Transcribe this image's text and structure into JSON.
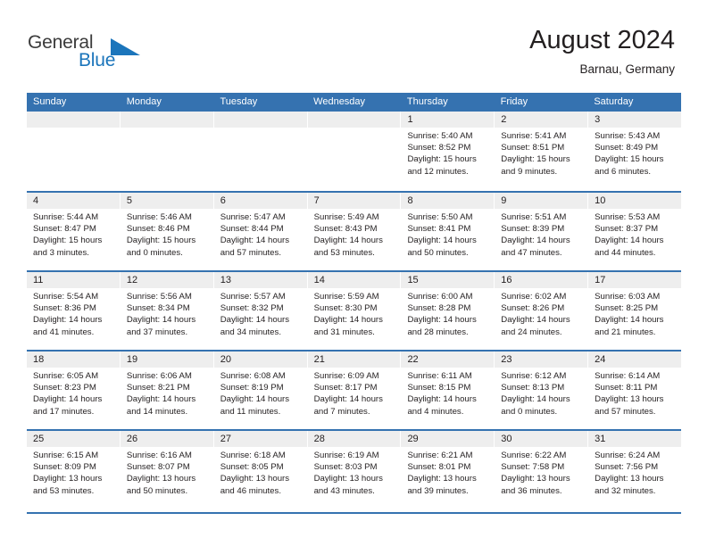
{
  "brand": {
    "name_part1": "General",
    "name_part2": "Blue",
    "accent_color": "#1b75bb"
  },
  "header": {
    "title": "August 2024",
    "location": "Barnau, Germany"
  },
  "theme": {
    "header_row_color": "#3572b0",
    "day_band_color": "#eeeeee",
    "text_color": "#231f20"
  },
  "weekdays": [
    "Sunday",
    "Monday",
    "Tuesday",
    "Wednesday",
    "Thursday",
    "Friday",
    "Saturday"
  ],
  "weeks": [
    [
      {
        "day": "",
        "lines": []
      },
      {
        "day": "",
        "lines": []
      },
      {
        "day": "",
        "lines": []
      },
      {
        "day": "",
        "lines": []
      },
      {
        "day": "1",
        "lines": [
          "Sunrise: 5:40 AM",
          "Sunset: 8:52 PM",
          "Daylight: 15 hours",
          "and 12 minutes."
        ]
      },
      {
        "day": "2",
        "lines": [
          "Sunrise: 5:41 AM",
          "Sunset: 8:51 PM",
          "Daylight: 15 hours",
          "and 9 minutes."
        ]
      },
      {
        "day": "3",
        "lines": [
          "Sunrise: 5:43 AM",
          "Sunset: 8:49 PM",
          "Daylight: 15 hours",
          "and 6 minutes."
        ]
      }
    ],
    [
      {
        "day": "4",
        "lines": [
          "Sunrise: 5:44 AM",
          "Sunset: 8:47 PM",
          "Daylight: 15 hours",
          "and 3 minutes."
        ]
      },
      {
        "day": "5",
        "lines": [
          "Sunrise: 5:46 AM",
          "Sunset: 8:46 PM",
          "Daylight: 15 hours",
          "and 0 minutes."
        ]
      },
      {
        "day": "6",
        "lines": [
          "Sunrise: 5:47 AM",
          "Sunset: 8:44 PM",
          "Daylight: 14 hours",
          "and 57 minutes."
        ]
      },
      {
        "day": "7",
        "lines": [
          "Sunrise: 5:49 AM",
          "Sunset: 8:43 PM",
          "Daylight: 14 hours",
          "and 53 minutes."
        ]
      },
      {
        "day": "8",
        "lines": [
          "Sunrise: 5:50 AM",
          "Sunset: 8:41 PM",
          "Daylight: 14 hours",
          "and 50 minutes."
        ]
      },
      {
        "day": "9",
        "lines": [
          "Sunrise: 5:51 AM",
          "Sunset: 8:39 PM",
          "Daylight: 14 hours",
          "and 47 minutes."
        ]
      },
      {
        "day": "10",
        "lines": [
          "Sunrise: 5:53 AM",
          "Sunset: 8:37 PM",
          "Daylight: 14 hours",
          "and 44 minutes."
        ]
      }
    ],
    [
      {
        "day": "11",
        "lines": [
          "Sunrise: 5:54 AM",
          "Sunset: 8:36 PM",
          "Daylight: 14 hours",
          "and 41 minutes."
        ]
      },
      {
        "day": "12",
        "lines": [
          "Sunrise: 5:56 AM",
          "Sunset: 8:34 PM",
          "Daylight: 14 hours",
          "and 37 minutes."
        ]
      },
      {
        "day": "13",
        "lines": [
          "Sunrise: 5:57 AM",
          "Sunset: 8:32 PM",
          "Daylight: 14 hours",
          "and 34 minutes."
        ]
      },
      {
        "day": "14",
        "lines": [
          "Sunrise: 5:59 AM",
          "Sunset: 8:30 PM",
          "Daylight: 14 hours",
          "and 31 minutes."
        ]
      },
      {
        "day": "15",
        "lines": [
          "Sunrise: 6:00 AM",
          "Sunset: 8:28 PM",
          "Daylight: 14 hours",
          "and 28 minutes."
        ]
      },
      {
        "day": "16",
        "lines": [
          "Sunrise: 6:02 AM",
          "Sunset: 8:26 PM",
          "Daylight: 14 hours",
          "and 24 minutes."
        ]
      },
      {
        "day": "17",
        "lines": [
          "Sunrise: 6:03 AM",
          "Sunset: 8:25 PM",
          "Daylight: 14 hours",
          "and 21 minutes."
        ]
      }
    ],
    [
      {
        "day": "18",
        "lines": [
          "Sunrise: 6:05 AM",
          "Sunset: 8:23 PM",
          "Daylight: 14 hours",
          "and 17 minutes."
        ]
      },
      {
        "day": "19",
        "lines": [
          "Sunrise: 6:06 AM",
          "Sunset: 8:21 PM",
          "Daylight: 14 hours",
          "and 14 minutes."
        ]
      },
      {
        "day": "20",
        "lines": [
          "Sunrise: 6:08 AM",
          "Sunset: 8:19 PM",
          "Daylight: 14 hours",
          "and 11 minutes."
        ]
      },
      {
        "day": "21",
        "lines": [
          "Sunrise: 6:09 AM",
          "Sunset: 8:17 PM",
          "Daylight: 14 hours",
          "and 7 minutes."
        ]
      },
      {
        "day": "22",
        "lines": [
          "Sunrise: 6:11 AM",
          "Sunset: 8:15 PM",
          "Daylight: 14 hours",
          "and 4 minutes."
        ]
      },
      {
        "day": "23",
        "lines": [
          "Sunrise: 6:12 AM",
          "Sunset: 8:13 PM",
          "Daylight: 14 hours",
          "and 0 minutes."
        ]
      },
      {
        "day": "24",
        "lines": [
          "Sunrise: 6:14 AM",
          "Sunset: 8:11 PM",
          "Daylight: 13 hours",
          "and 57 minutes."
        ]
      }
    ],
    [
      {
        "day": "25",
        "lines": [
          "Sunrise: 6:15 AM",
          "Sunset: 8:09 PM",
          "Daylight: 13 hours",
          "and 53 minutes."
        ]
      },
      {
        "day": "26",
        "lines": [
          "Sunrise: 6:16 AM",
          "Sunset: 8:07 PM",
          "Daylight: 13 hours",
          "and 50 minutes."
        ]
      },
      {
        "day": "27",
        "lines": [
          "Sunrise: 6:18 AM",
          "Sunset: 8:05 PM",
          "Daylight: 13 hours",
          "and 46 minutes."
        ]
      },
      {
        "day": "28",
        "lines": [
          "Sunrise: 6:19 AM",
          "Sunset: 8:03 PM",
          "Daylight: 13 hours",
          "and 43 minutes."
        ]
      },
      {
        "day": "29",
        "lines": [
          "Sunrise: 6:21 AM",
          "Sunset: 8:01 PM",
          "Daylight: 13 hours",
          "and 39 minutes."
        ]
      },
      {
        "day": "30",
        "lines": [
          "Sunrise: 6:22 AM",
          "Sunset: 7:58 PM",
          "Daylight: 13 hours",
          "and 36 minutes."
        ]
      },
      {
        "day": "31",
        "lines": [
          "Sunrise: 6:24 AM",
          "Sunset: 7:56 PM",
          "Daylight: 13 hours",
          "and 32 minutes."
        ]
      }
    ]
  ]
}
